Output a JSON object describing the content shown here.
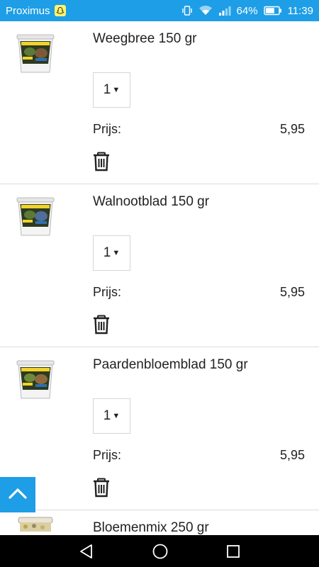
{
  "status_bar": {
    "carrier": "Proximus",
    "battery": "64%",
    "time": "11:39",
    "background_color": "#1e9ee6"
  },
  "cart": {
    "items": [
      {
        "name": "Weegbree 150 gr",
        "quantity": "1",
        "price_label": "Prijs:",
        "price": "5,95",
        "icon": "product-bucket-icon"
      },
      {
        "name": "Walnootblad 150 gr",
        "quantity": "1",
        "price_label": "Prijs:",
        "price": "5,95",
        "icon": "product-bucket-icon"
      },
      {
        "name": "Paardenbloemblad 150 gr",
        "quantity": "1",
        "price_label": "Prijs:",
        "price": "5,95",
        "icon": "product-bucket-icon"
      },
      {
        "name": "Bloemenmix 250 gr",
        "icon": "product-jar-icon"
      }
    ]
  },
  "icons": {
    "delete": "trash-icon",
    "scroll_top": "chevron-up-icon",
    "nav": [
      "back-icon",
      "home-icon",
      "recents-icon"
    ]
  },
  "colors": {
    "accent": "#1e9ee6",
    "divider": "#dcdcdc",
    "nav_background": "#000000"
  }
}
